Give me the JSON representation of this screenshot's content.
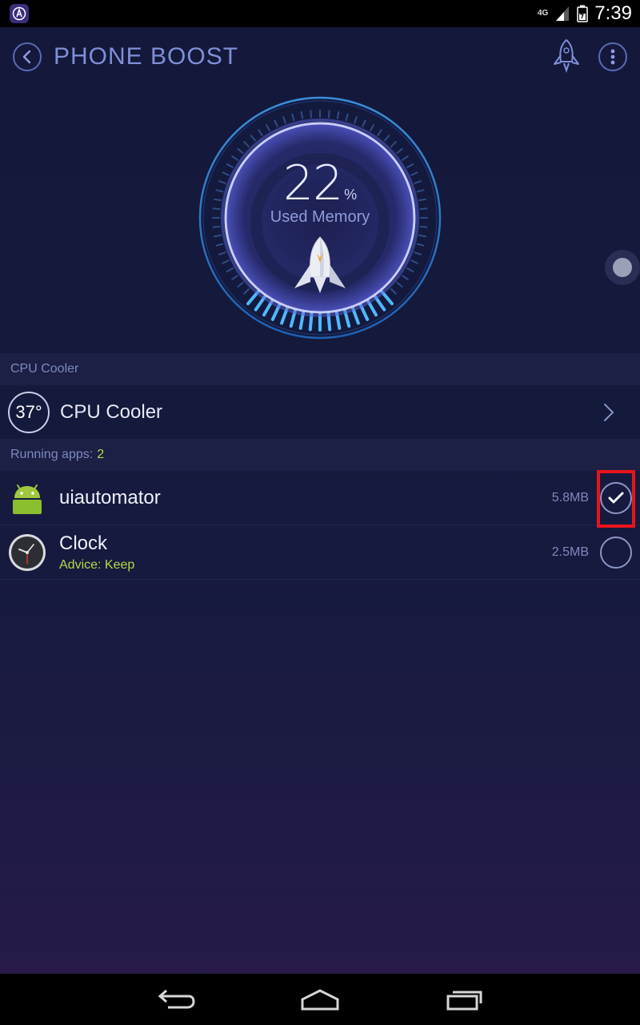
{
  "status_bar": {
    "network": "4G",
    "time": "7:39"
  },
  "header": {
    "title": "PHONE BOOST"
  },
  "gauge": {
    "value": "22",
    "unit": "%",
    "label": "Used Memory",
    "used_fraction": 0.22
  },
  "cpu_section": {
    "header": "CPU Cooler",
    "temperature": "37°",
    "label": "CPU Cooler"
  },
  "running_section": {
    "label": "Running apps:",
    "count": "2"
  },
  "apps": [
    {
      "name": "uiautomator",
      "size": "5.8MB",
      "checked": true,
      "icon": "android-icon"
    },
    {
      "name": "Clock",
      "advice": "Advice: Keep",
      "size": "2.5MB",
      "checked": false,
      "icon": "clock-icon"
    }
  ],
  "colors": {
    "accent": "#7f8fd6",
    "advice": "#b6d84a",
    "highlight": "#e8141b"
  }
}
